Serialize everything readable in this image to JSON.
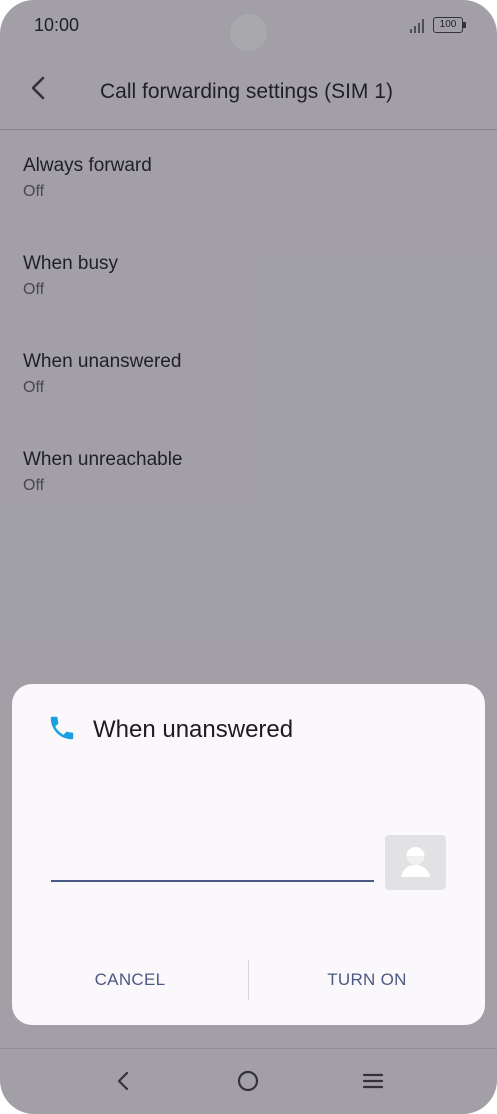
{
  "status_bar": {
    "time": "10:00",
    "battery": "100"
  },
  "app_bar": {
    "title": "Call forwarding settings (SIM 1)"
  },
  "settings": {
    "items": [
      {
        "title": "Always forward",
        "value": "Off"
      },
      {
        "title": "When busy",
        "value": "Off"
      },
      {
        "title": "When unanswered",
        "value": "Off"
      },
      {
        "title": "When unreachable",
        "value": "Off"
      }
    ]
  },
  "dialog": {
    "title": "When unanswered",
    "input_value": "",
    "cancel_label": "CANCEL",
    "turn_on_label": "TURN ON",
    "icon_color": "#1a9fe0",
    "accent_color": "#4a5a85"
  },
  "icons": {
    "back": "back-arrow-icon",
    "phone": "phone-icon",
    "contact": "contact-icon",
    "signal": "signal-icon",
    "battery": "battery-icon",
    "nav_back": "nav-back-icon",
    "nav_home": "nav-home-icon",
    "nav_menu": "nav-menu-icon"
  }
}
